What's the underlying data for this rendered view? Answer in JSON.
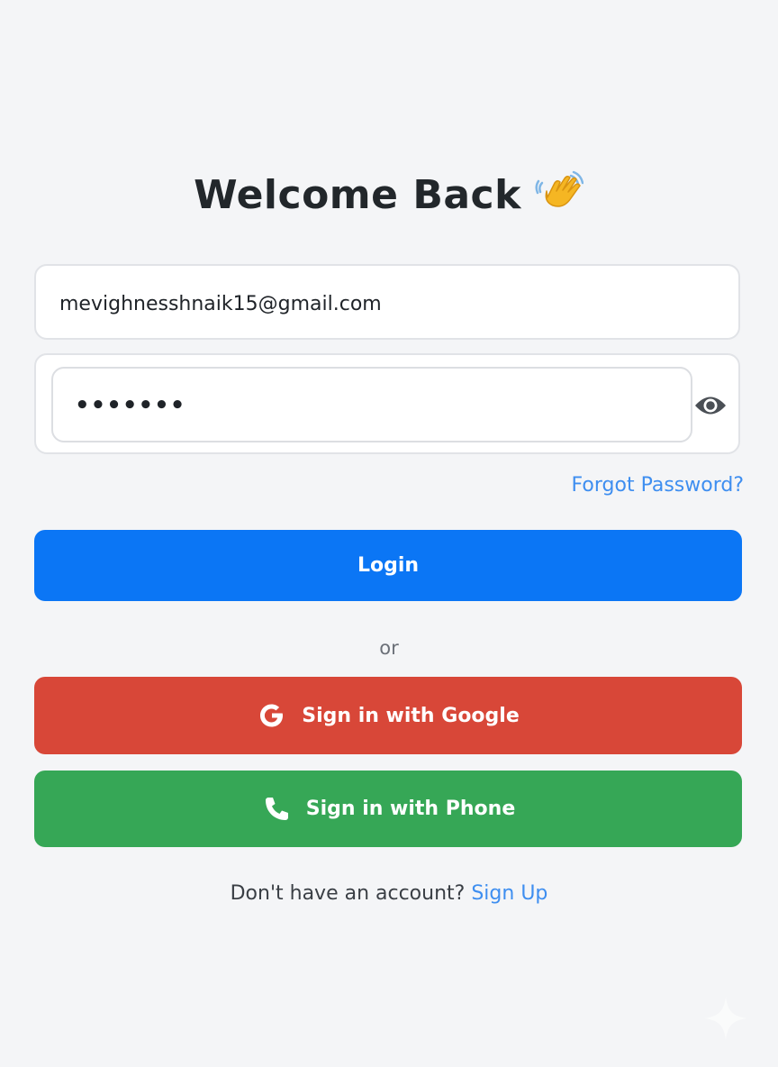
{
  "header": {
    "title": "Welcome Back",
    "emoji": "waving-hand-icon"
  },
  "form": {
    "email_value": "mevighnesshnaik15@gmail.com",
    "password_masked": "•••••••",
    "eye_icon": "eye-icon",
    "forgot_label": "Forgot Password?"
  },
  "actions": {
    "login_label": "Login",
    "divider_text": "or",
    "google_label": "Sign in with Google",
    "google_icon": "google-icon",
    "phone_label": "Sign in with Phone",
    "phone_icon": "phone-icon"
  },
  "footer": {
    "prompt": "Don't have an account?",
    "signup_label": "Sign Up"
  },
  "colors": {
    "background": "#f4f5f7",
    "primary": "#0b76f5",
    "google": "#d84738",
    "phone": "#36a756",
    "link": "#3e8ef0"
  }
}
